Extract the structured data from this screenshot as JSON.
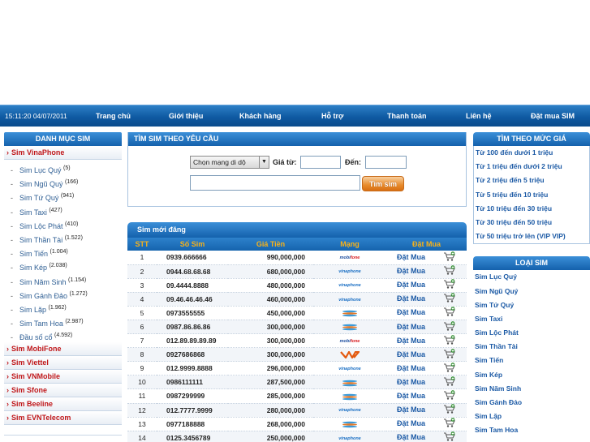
{
  "nav": {
    "clock": "15:11:20 04/07/2011",
    "items": [
      "Trang chủ",
      "Giới thiệu",
      "Khách hàng",
      "Hỗ trợ",
      "Thanh toán",
      "Liên hệ",
      "Đặt mua SIM"
    ]
  },
  "left": {
    "title": "DANH MỤC SIM",
    "network_vina": "Sim VinaPhone",
    "categories": [
      {
        "name": "Sim Lục Quý",
        "count": "(5)"
      },
      {
        "name": "Sim Ngũ Quý",
        "count": "(166)"
      },
      {
        "name": "Sim Tứ Quý",
        "count": "(941)"
      },
      {
        "name": "Sim Taxi",
        "count": "(427)"
      },
      {
        "name": "Sim Lộc Phát",
        "count": "(410)"
      },
      {
        "name": "Sim Thần Tài",
        "count": "(1.522)"
      },
      {
        "name": "Sim Tiến",
        "count": "(1.004)"
      },
      {
        "name": "Sim Kép",
        "count": "(2.038)"
      },
      {
        "name": "Sim Năm Sinh",
        "count": "(1.154)"
      },
      {
        "name": "Sim Gánh Đảo",
        "count": "(1.272)"
      },
      {
        "name": "Sim Lặp",
        "count": "(1.962)"
      },
      {
        "name": "Sim Tam Hoa",
        "count": "(2.987)"
      },
      {
        "name": "Đầu số cổ",
        "count": "(4.592)"
      }
    ],
    "networks": [
      "Sim MobiFone",
      "Sim Viettel",
      "Sim VNMobile",
      "Sim Sfone",
      "Sim Beeline",
      "Sim EVNTelecom"
    ]
  },
  "search": {
    "title": "TÌM SIM THEO YÊU CẦU",
    "network_select": "Chọn mạng di dộ",
    "price_from_label": "Giá từ:",
    "price_to_label": "Đến:",
    "price_from_value": "",
    "price_to_value": "",
    "number_value": "",
    "button": "Tìm sim"
  },
  "sims": {
    "title": "Sim mới đăng",
    "headers": [
      "STT",
      "Số Sim",
      "Giá Tiền",
      "Mạng",
      "Đặt Mua"
    ],
    "rows": [
      {
        "stt": "1",
        "number": "0939.666666",
        "price": "990,000,000",
        "network": "mobifone",
        "buy": "Đặt Mua"
      },
      {
        "stt": "2",
        "number": "0944.68.68.68",
        "price": "680,000,000",
        "network": "vinaphone",
        "buy": "Đặt Mua"
      },
      {
        "stt": "3",
        "number": "09.4444.8888",
        "price": "480,000,000",
        "network": "vinaphone",
        "buy": "Đặt Mua"
      },
      {
        "stt": "4",
        "number": "09.46.46.46.46",
        "price": "460,000,000",
        "network": "vinaphone",
        "buy": "Đặt Mua"
      },
      {
        "stt": "5",
        "number": "0973555555",
        "price": "450,000,000",
        "network": "sfone",
        "buy": "Đặt Mua"
      },
      {
        "stt": "6",
        "number": "0987.86.86.86",
        "price": "300,000,000",
        "network": "sfone",
        "buy": "Đặt Mua"
      },
      {
        "stt": "7",
        "number": "012.89.89.89.89",
        "price": "300,000,000",
        "network": "mobifone",
        "buy": "Đặt Mua"
      },
      {
        "stt": "8",
        "number": "0927686868",
        "price": "300,000,000",
        "network": "viettel",
        "buy": "Đặt Mua"
      },
      {
        "stt": "9",
        "number": "012.9999.8888",
        "price": "296,000,000",
        "network": "vinaphone",
        "buy": "Đặt Mua"
      },
      {
        "stt": "10",
        "number": "0986111111",
        "price": "287,500,000",
        "network": "sfone",
        "buy": "Đặt Mua"
      },
      {
        "stt": "11",
        "number": "0987299999",
        "price": "285,000,000",
        "network": "sfone",
        "buy": "Đặt Mua"
      },
      {
        "stt": "12",
        "number": "012.7777.9999",
        "price": "280,000,000",
        "network": "vinaphone",
        "buy": "Đặt Mua"
      },
      {
        "stt": "13",
        "number": "0977188888",
        "price": "268,000,000",
        "network": "sfone",
        "buy": "Đặt Mua"
      },
      {
        "stt": "14",
        "number": "0125.3456789",
        "price": "250,000,000",
        "network": "vinaphone",
        "buy": "Đặt Mua"
      }
    ]
  },
  "right": {
    "price_title": "TÌM THEO MỨC GIÁ",
    "price_ranges": [
      "Từ 100 đến dưới 1 triệu",
      "Từ 1 triệu đến dưới 2 triệu",
      "Từ 2 triệu đến 5 triệu",
      "Từ 5 triệu đến 10 triệu",
      "Từ 10 triệu đến 30 triệu",
      "Từ 30 triệu đến 50 triệu",
      "Từ 50 triệu trở lên (VIP VIP)"
    ],
    "types_title": "LOẠI SIM",
    "types": [
      "Sim Lục Quý",
      "Sim Ngũ Quý",
      "Sim Tứ Quý",
      "Sim Taxi",
      "Sim Lộc Phát",
      "Sim Thần Tài",
      "Sim Tiến",
      "Sim Kép",
      "Sim Năm Sinh",
      "Sim Gánh Đảo",
      "Sim Lặp",
      "Sim Tam Hoa"
    ]
  },
  "colors": {
    "nav_bg": "#0f5aa2",
    "accent_red": "#c0181b",
    "header_gold": "#f7b21a",
    "link_blue": "#1c5aa5"
  }
}
